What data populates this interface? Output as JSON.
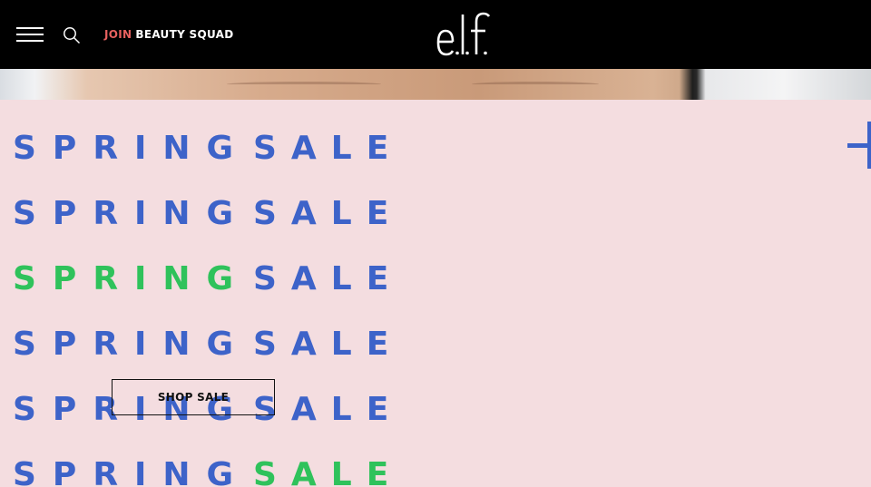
{
  "header": {
    "menu_icon": "hamburger-menu-icon",
    "search_icon": "search-icon",
    "join_label": "JOIN",
    "squad_label": "BEAUTY SQUAD",
    "logo_text": "e.l.f."
  },
  "promo": {
    "rows": [
      {
        "word1": "SPRING",
        "word2": "SALE",
        "word1_color": "#3d63c9",
        "word2_color": "#3d63c9"
      },
      {
        "word1": "SPRING",
        "word2": "SALE",
        "word1_color": "#3d63c9",
        "word2_color": "#3d63c9"
      },
      {
        "word1": "SPRING",
        "word2": "SALE",
        "word1_color": "#2fc25b",
        "word2_color": "#3d63c9"
      },
      {
        "word1": "SPRING",
        "word2": "SALE",
        "word1_color": "#3d63c9",
        "word2_color": "#3d63c9"
      },
      {
        "word1": "SPRING",
        "word2": "SALE",
        "word1_color": "#3d63c9",
        "word2_color": "#3d63c9"
      },
      {
        "word1": "SPRING",
        "word2": "SALE",
        "word1_color": "#3d63c9",
        "word2_color": "#2fc25b"
      }
    ],
    "shop_button_label": "SHOP SALE",
    "expand_icon": "plus-icon"
  },
  "colors": {
    "header_bg": "#000000",
    "panel_bg": "#f4dde0",
    "brand_blue": "#3d63c9",
    "brand_green": "#2fc25b",
    "join_accent": "#e8615f"
  }
}
